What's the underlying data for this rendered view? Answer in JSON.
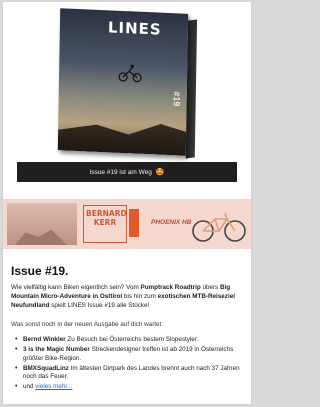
{
  "hero": {
    "magazine_logo": "LINES",
    "issue_tag": "#19",
    "caption": "Issue #19 ist am Weg",
    "caption_emoji": "🤩"
  },
  "banner": {
    "brand": "BERNARD KERR",
    "model": "PHOENIX HB"
  },
  "article": {
    "headline": "Issue #19.",
    "intro_parts": [
      "Wie vielfältig kann Biken eigentlich sein? Vom ",
      "Pumptrack Roadtrip",
      " übers ",
      "Big Mountain Micro-Adventure in Osttirol",
      " bis hin zum ",
      "exotischen MTB-Reiseziel Neufundland",
      " spielt LINES Issue #19 alle Stücke!"
    ],
    "sub": "Was sonst noch in der neuen Ausgabe auf dich wartet:",
    "list": [
      {
        "bold": "Bernd Winkler",
        "text": " Zu Besuch bei Österreichs bestem Slopestyler."
      },
      {
        "bold": "3 is the Magic Number",
        "text": " Streckendesigner treffen ist ab 2019 in Österreichs größter Bike-Region."
      },
      {
        "bold": "BMXSquadLinz",
        "text": " Im ältesten Dirtpark des Landes brennt auch nach 37 Jahren noch das Feuer."
      },
      {
        "bold": "",
        "text": "und ",
        "link": "vieles mehr..."
      }
    ]
  }
}
